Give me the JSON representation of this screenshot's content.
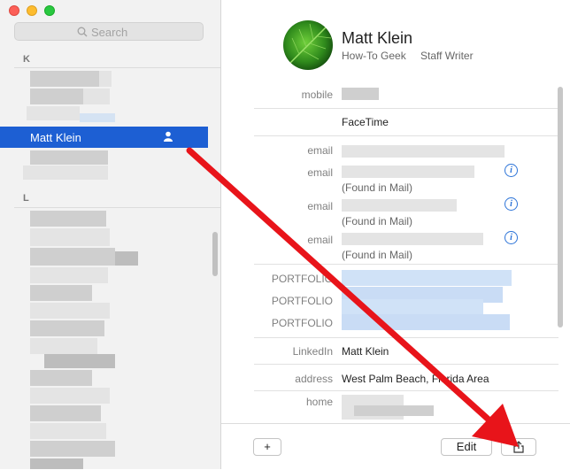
{
  "search": {
    "placeholder": "Search"
  },
  "sidebar": {
    "section_k": "K",
    "section_l": "L",
    "selected_contact": "Matt Klein"
  },
  "contact": {
    "name": "Matt Klein",
    "company": "How-To Geek",
    "job_title": "Staff Writer",
    "fields": {
      "mobile_label": "mobile",
      "facetime_value": "FaceTime",
      "email_label": "email",
      "found_in_mail": "(Found in Mail)",
      "portfolio_label": "PORTFOLIO",
      "linkedin_label": "LinkedIn",
      "linkedin_value": "Matt Klein",
      "address_label": "address",
      "address_value": "West Palm Beach, Florida Area",
      "home_label": "home"
    }
  },
  "toolbar": {
    "add_label": "+",
    "edit_label": "Edit"
  },
  "colors": {
    "selection": "#1d5fd3",
    "arrow": "#e8141a",
    "info_blue": "#2d74d8"
  }
}
